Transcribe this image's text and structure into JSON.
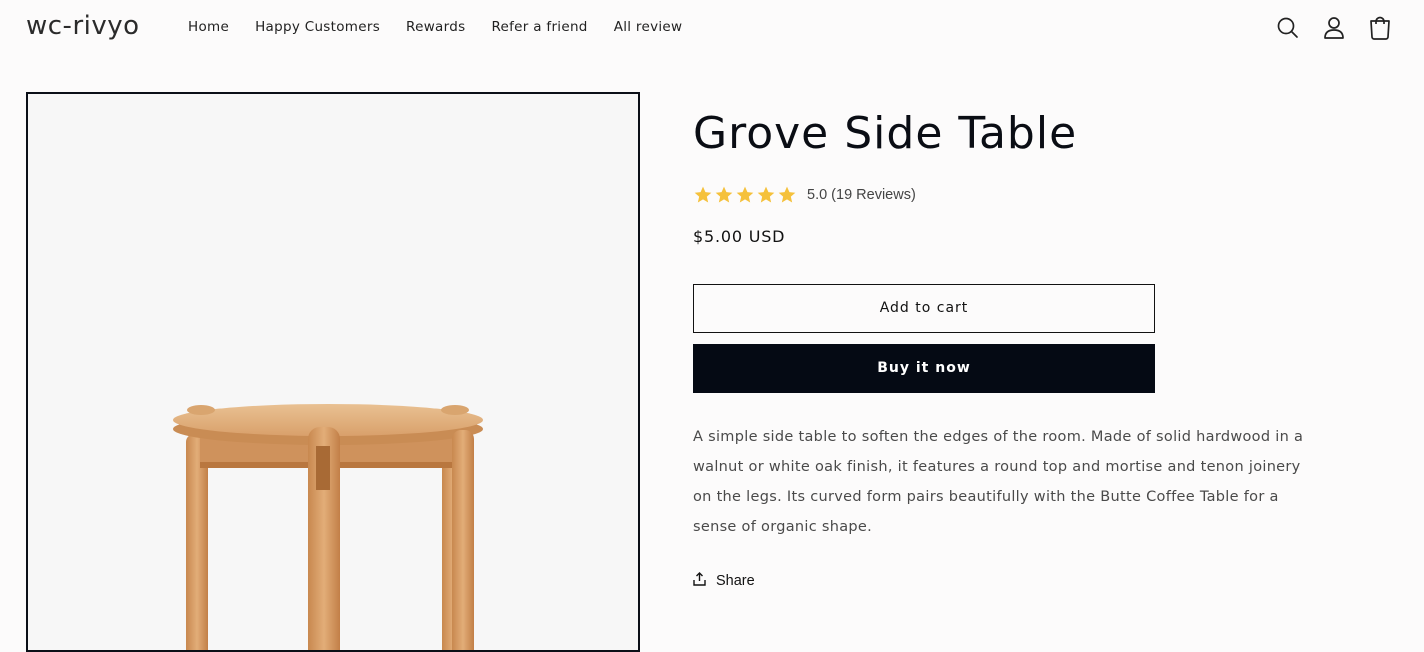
{
  "header": {
    "logo": "wc-rivyo",
    "nav": [
      "Home",
      "Happy Customers",
      "Rewards",
      "Refer a friend",
      "All review"
    ],
    "icons": [
      "search-icon",
      "account-icon",
      "cart-icon"
    ]
  },
  "product": {
    "title": "Grove Side Table",
    "rating_value": 5.0,
    "stars_filled": 5,
    "rating_text": "5.0 (19 Reviews)",
    "price": "$5.00 USD",
    "add_to_cart_label": "Add to cart",
    "buy_now_label": "Buy it now",
    "description": "A simple side table to soften the edges of the room. Made of solid hardwood in a walnut or white oak finish, it features a round top and mortise and tenon joinery on the legs. Its curved form pairs beautifully with the Butte Coffee Table for a sense of organic shape.",
    "share_label": "Share"
  },
  "colors": {
    "star": "#f5c13b",
    "buy_button": "#050a14",
    "wood": "#d9a06b"
  }
}
